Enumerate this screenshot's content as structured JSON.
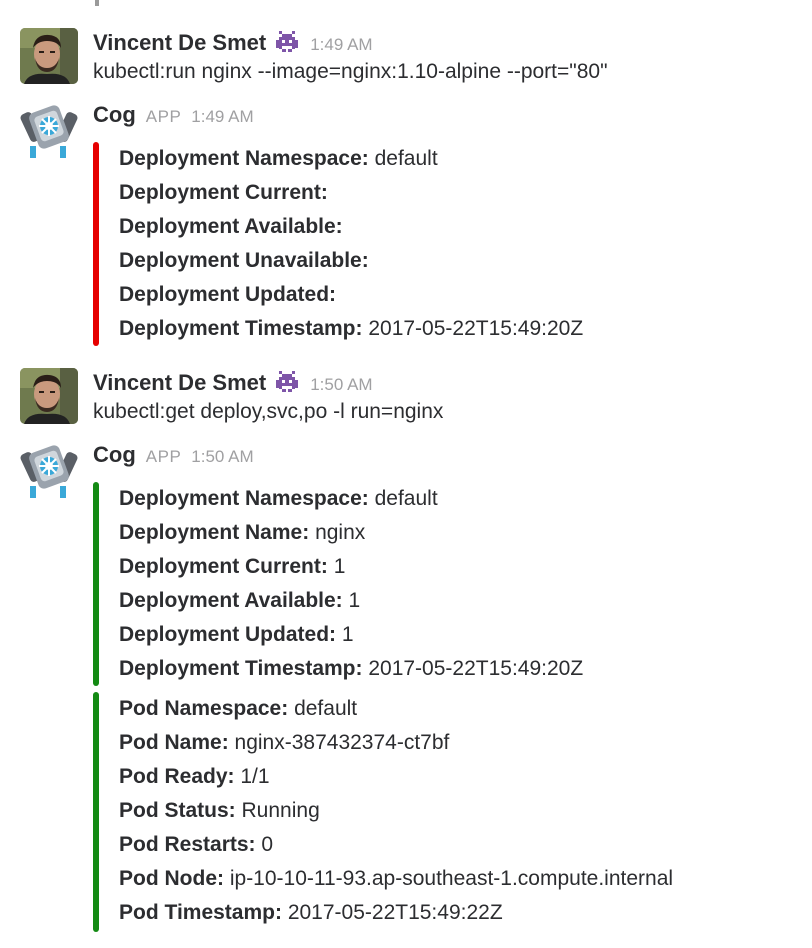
{
  "colors": {
    "danger": "#e60000",
    "good": "#138a13",
    "muted": "#a0a0a2",
    "text": "#2c2d30"
  },
  "messages": [
    {
      "sender": "Vincent De Smet",
      "avatar": "user-photo",
      "status_emoji": "space-invader-icon",
      "time": "1:49 AM",
      "text": "kubectl:run nginx --image=nginx:1.10-alpine --port=\"80\""
    },
    {
      "sender": "Cog",
      "avatar": "cog-robot-icon",
      "badge": "APP",
      "time": "1:49 AM",
      "attachments": [
        {
          "color": "#e60000",
          "fields": [
            {
              "k": "Deployment Namespace:",
              "v": "default"
            },
            {
              "k": "Deployment Current:",
              "v": ""
            },
            {
              "k": "Deployment Available:",
              "v": ""
            },
            {
              "k": "Deployment Unavailable:",
              "v": ""
            },
            {
              "k": "Deployment Updated:",
              "v": ""
            },
            {
              "k": "Deployment Timestamp:",
              "v": "2017-05-22T15:49:20Z"
            }
          ]
        }
      ]
    },
    {
      "sender": "Vincent De Smet",
      "avatar": "user-photo",
      "status_emoji": "space-invader-icon",
      "time": "1:50 AM",
      "text": "kubectl:get deploy,svc,po -l run=nginx"
    },
    {
      "sender": "Cog",
      "avatar": "cog-robot-icon",
      "badge": "APP",
      "time": "1:50 AM",
      "attachments": [
        {
          "color": "#138a13",
          "fields": [
            {
              "k": "Deployment Namespace:",
              "v": "default"
            },
            {
              "k": "Deployment Name:",
              "v": "nginx"
            },
            {
              "k": "Deployment Current:",
              "v": "1"
            },
            {
              "k": "Deployment Available:",
              "v": "1"
            },
            {
              "k": "Deployment Updated:",
              "v": "1"
            },
            {
              "k": "Deployment Timestamp:",
              "v": "2017-05-22T15:49:20Z"
            }
          ]
        },
        {
          "color": "#138a13",
          "fields": [
            {
              "k": "Pod Namespace:",
              "v": "default"
            },
            {
              "k": "Pod Name:",
              "v": "nginx-387432374-ct7bf"
            },
            {
              "k": "Pod Ready:",
              "v": "1/1"
            },
            {
              "k": "Pod Status:",
              "v": "Running"
            },
            {
              "k": "Pod Restarts:",
              "v": "0"
            },
            {
              "k": "Pod Node:",
              "v": "ip-10-10-11-93.ap-southeast-1.compute.internal"
            },
            {
              "k": "Pod Timestamp:",
              "v": "2017-05-22T15:49:22Z"
            }
          ]
        }
      ]
    }
  ]
}
